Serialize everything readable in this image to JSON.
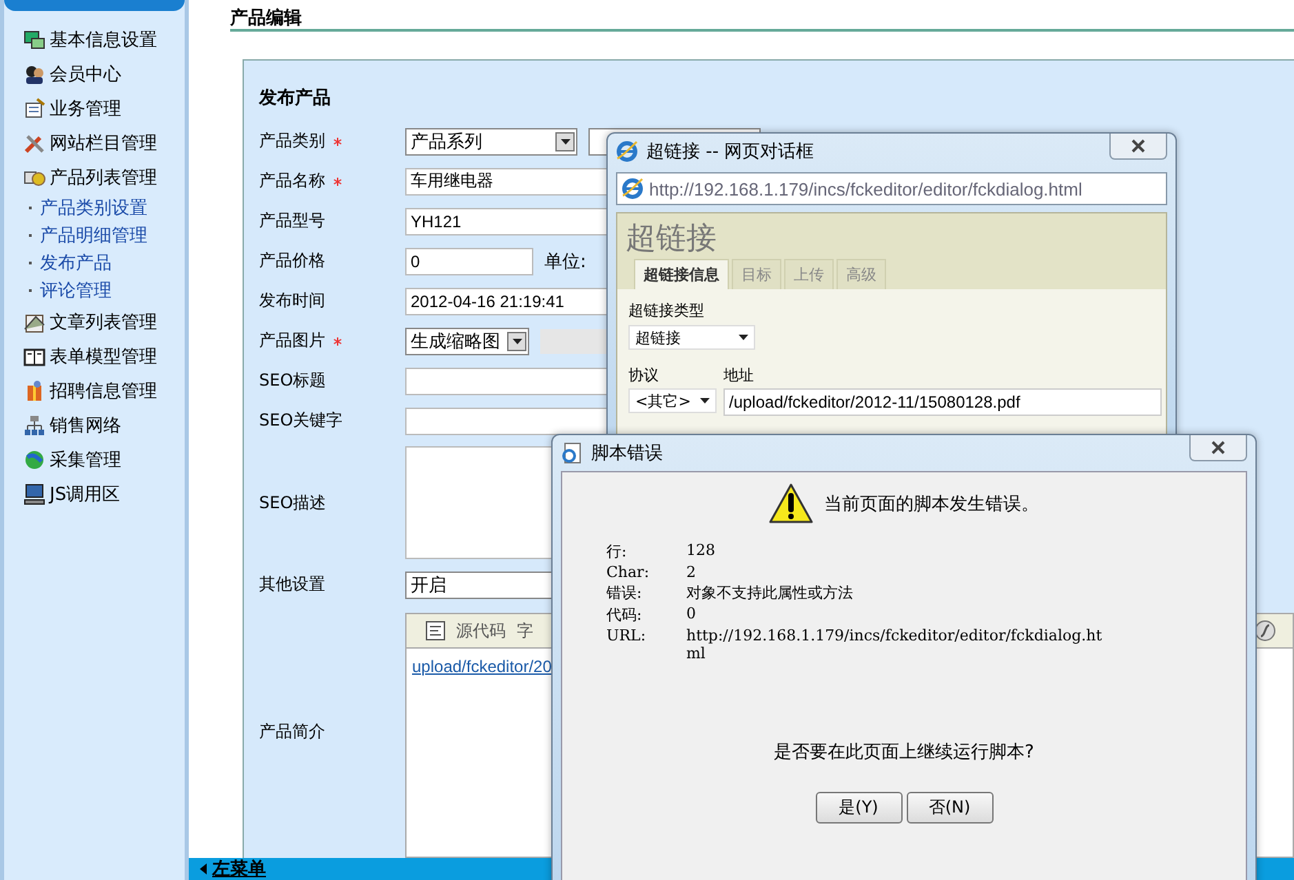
{
  "sidebar": {
    "items": [
      {
        "label": "基本信息设置"
      },
      {
        "label": "会员中心"
      },
      {
        "label": "业务管理"
      },
      {
        "label": "网站栏目管理"
      },
      {
        "label": "产品列表管理",
        "children": [
          {
            "label": "产品类别设置"
          },
          {
            "label": "产品明细管理"
          },
          {
            "label": "发布产品"
          },
          {
            "label": "评论管理"
          }
        ]
      },
      {
        "label": "文章列表管理"
      },
      {
        "label": "表单模型管理"
      },
      {
        "label": "招聘信息管理"
      },
      {
        "label": "销售网络"
      },
      {
        "label": "采集管理"
      },
      {
        "label": "JS调用区"
      }
    ]
  },
  "page_title": "产品编辑",
  "form": {
    "title": "发布产品",
    "rows": [
      {
        "label": "产品类别",
        "required": true,
        "kind": "select2",
        "value": "产品系列"
      },
      {
        "label": "产品名称",
        "required": true,
        "kind": "text",
        "value": "车用继电器"
      },
      {
        "label": "产品型号",
        "required": false,
        "kind": "text",
        "value": "YH121"
      },
      {
        "label": "产品价格",
        "required": false,
        "kind": "price",
        "value": "0",
        "unit_label": "单位:"
      },
      {
        "label": "发布时间",
        "required": false,
        "kind": "text",
        "value": "2012-04-16 21:19:41"
      },
      {
        "label": "产品图片",
        "required": true,
        "kind": "image",
        "value": "生成缩略图"
      },
      {
        "label": "SEO标题",
        "required": false,
        "kind": "text"
      },
      {
        "label": "SEO关键字",
        "required": false,
        "kind": "text"
      },
      {
        "label": "SEO描述",
        "required": false,
        "kind": "textarea"
      },
      {
        "label": "其他设置",
        "required": false,
        "kind": "select",
        "value": "开启"
      },
      {
        "label": "产品简介",
        "required": false,
        "kind": "editor",
        "toolbar": [
          "源代码",
          "字"
        ],
        "content_link": "upload/fckeditor/20"
      }
    ]
  },
  "bottom_bar": {
    "label": "左菜单"
  },
  "link_dialog": {
    "title": "超链接 -- 网页对话框",
    "address": "http://192.168.1.179/incs/fckeditor/editor/fckdialog.html",
    "heading": "超链接",
    "tabs": [
      {
        "label": "超链接信息",
        "selected": true
      },
      {
        "label": "目标",
        "selected": false
      },
      {
        "label": "上传",
        "selected": false
      },
      {
        "label": "高级",
        "selected": false
      }
    ],
    "type_label": "超链接类型",
    "type_value": "超链接",
    "protocol_label": "协议",
    "protocol_value": "<其它>",
    "url_label": "地址",
    "url_value": "/upload/fckeditor/2012-11/15080128.pdf"
  },
  "error_dialog": {
    "title": "脚本错误",
    "message": "当前页面的脚本发生错误。",
    "details": [
      {
        "key": "行:",
        "value": "128"
      },
      {
        "key": "Char:",
        "value": "2"
      },
      {
        "key": "错误:",
        "value": "对象不支持此属性或方法"
      },
      {
        "key": "代码:",
        "value": "0"
      },
      {
        "key": "URL:",
        "value": "http://192.168.1.179/incs/fckeditor/editor/fckdialog.ht\nml"
      }
    ],
    "question": "是否要在此页面上继续运行脚本?",
    "buttons": [
      "是(Y)",
      "否(N)"
    ]
  }
}
